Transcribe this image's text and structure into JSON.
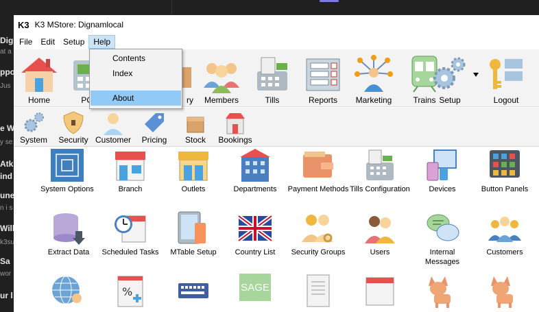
{
  "background": {
    "fragments": [
      {
        "text": "Dig",
        "sub": false
      },
      {
        "text": "at a",
        "sub": true
      },
      {
        "text": "ppo",
        "sub": false
      },
      {
        "text": "Jus",
        "sub": true
      },
      {
        "text": "e W",
        "sub": false
      },
      {
        "text": "y se",
        "sub": true
      },
      {
        "text": "Atk",
        "sub": false
      },
      {
        "text": "ind",
        "sub": false
      },
      {
        "text": "une",
        "sub": false
      },
      {
        "text": "n i s",
        "sub": true
      },
      {
        "text": "Will",
        "sub": false
      },
      {
        "text": "k3su",
        "sub": true
      },
      {
        "text": "Sa",
        "sub": false
      },
      {
        "text": "wor",
        "sub": true
      },
      {
        "text": "ur l",
        "sub": false
      }
    ]
  },
  "window": {
    "logo": "K3",
    "title": "K3 MStore: Dignamlocal"
  },
  "menu": {
    "items": [
      "File",
      "Edit",
      "Setup",
      "Help"
    ],
    "active": "Help"
  },
  "help_menu": {
    "items": [
      "Contents",
      "Index",
      "About"
    ],
    "highlighted": "About"
  },
  "toolbar": {
    "items": [
      {
        "label": "Home",
        "icon": "house-icon"
      },
      {
        "label": "POS",
        "icon": "register-icon"
      },
      {
        "label": "Inventory",
        "icon": "inventory-icon"
      },
      {
        "label": "Members",
        "icon": "people-icon"
      },
      {
        "label": "Tills",
        "icon": "till-icon"
      },
      {
        "label": "Reports",
        "icon": "checklist-icon"
      },
      {
        "label": "Marketing",
        "icon": "network-icon"
      },
      {
        "label": "Trains",
        "icon": "train-icon"
      },
      {
        "label": "Setup",
        "icon": "gears-icon"
      },
      {
        "label": "Logout",
        "icon": "keys-icon"
      }
    ]
  },
  "tabs": {
    "items": [
      {
        "label": "System",
        "icon": "gears-icon"
      },
      {
        "label": "Security",
        "icon": "shield-icon"
      },
      {
        "label": "Customer",
        "icon": "user-icon"
      },
      {
        "label": "Pricing",
        "icon": "price-tag-icon"
      },
      {
        "label": "Stock",
        "icon": "box-icon"
      },
      {
        "label": "Bookings",
        "icon": "shop-icon"
      }
    ]
  },
  "system_items": [
    {
      "label": "System Options",
      "icon": "system-options-icon",
      "selected": true
    },
    {
      "label": "Branch",
      "icon": "branch-store-icon"
    },
    {
      "label": "Outlets",
      "icon": "outlet-store-icon"
    },
    {
      "label": "Departments",
      "icon": "building-icon"
    },
    {
      "label": "Payment Methods",
      "icon": "wallet-icon"
    },
    {
      "label": "Tills Configuration",
      "icon": "cash-register-icon"
    },
    {
      "label": "Devices",
      "icon": "devices-icon"
    },
    {
      "label": "Button Panels",
      "icon": "button-panel-icon"
    },
    {
      "label": "Extract Data",
      "icon": "database-export-icon"
    },
    {
      "label": "Scheduled Tasks",
      "icon": "calendar-clock-icon"
    },
    {
      "label": "MTable Setup",
      "icon": "tablet-phone-icon"
    },
    {
      "label": "Country List",
      "icon": "uk-flag-icon"
    },
    {
      "label": "Security Groups",
      "icon": "group-key-icon"
    },
    {
      "label": "Users",
      "icon": "users-icon"
    },
    {
      "label": "Internal Messages",
      "label2": "Messages",
      "icon": "chat-icon"
    },
    {
      "label": "Customers",
      "icon": "customers-icon"
    },
    {
      "label": "",
      "icon": "globe-user-icon"
    },
    {
      "label": "",
      "icon": "percent-calendar-icon"
    },
    {
      "label": "",
      "icon": "keyboard-icon"
    },
    {
      "label": "SAGE",
      "icon": "sage-icon"
    },
    {
      "label": "",
      "icon": "document-list-icon"
    },
    {
      "label": "",
      "icon": "calendar-icon"
    },
    {
      "label": "",
      "icon": "dog-icon"
    },
    {
      "label": "",
      "icon": "dog-icon"
    }
  ],
  "colors": {
    "selection": "#0078d7",
    "menu_highlight": "#91c9f7",
    "menu_active": "#cce4f7"
  }
}
